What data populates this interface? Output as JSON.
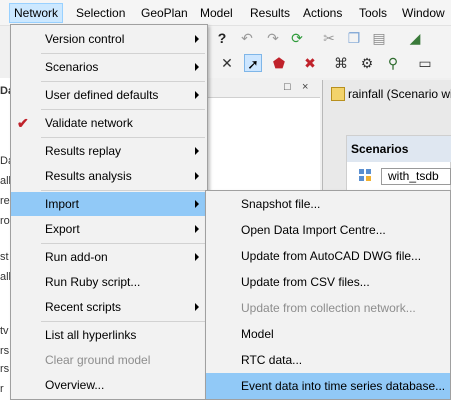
{
  "menubar": {
    "items": [
      "Network",
      "Selection",
      "GeoPlan",
      "Model",
      "Results",
      "Actions",
      "Tools",
      "Window"
    ]
  },
  "left_panel": {
    "title_fragment": "Da",
    "row_fragments": [
      "Da",
      "all",
      "re",
      "ro",
      "st",
      "all",
      "tv",
      "rs",
      "rs",
      "r"
    ]
  },
  "pane": {
    "buttons": [
      "□",
      "×"
    ]
  },
  "document": {
    "title": "rainfall (Scenario wi",
    "scenarios_header": "Scenarios",
    "scenario_value": "with_tsdb"
  },
  "network_menu": {
    "items": [
      {
        "label": "Version control",
        "submenu": true,
        "disabled": false
      },
      {
        "label": "Scenarios",
        "submenu": true,
        "disabled": false
      },
      {
        "label": "User defined defaults",
        "submenu": true,
        "disabled": false
      },
      {
        "label": "Validate network",
        "submenu": false,
        "disabled": false,
        "checked": true
      },
      {
        "label": "Results replay",
        "submenu": true,
        "disabled": false
      },
      {
        "label": "Results analysis",
        "submenu": true,
        "disabled": false
      },
      {
        "label": "Import",
        "submenu": true,
        "disabled": false,
        "highlighted": true
      },
      {
        "label": "Export",
        "submenu": true,
        "disabled": false
      },
      {
        "label": "Run add-on",
        "submenu": true,
        "disabled": false
      },
      {
        "label": "Run Ruby script...",
        "submenu": false,
        "disabled": false
      },
      {
        "label": "Recent scripts",
        "submenu": true,
        "disabled": false
      },
      {
        "label": "List all hyperlinks",
        "submenu": false,
        "disabled": false
      },
      {
        "label": "Clear ground model",
        "submenu": false,
        "disabled": true
      },
      {
        "label": "Overview...",
        "submenu": false,
        "disabled": false
      }
    ]
  },
  "import_submenu": {
    "items": [
      {
        "label": "Snapshot file...",
        "disabled": false
      },
      {
        "label": "Open Data Import Centre...",
        "disabled": false
      },
      {
        "label": "Update from AutoCAD DWG file...",
        "disabled": false
      },
      {
        "label": "Update from CSV files...",
        "disabled": false
      },
      {
        "label": "Update from collection network...",
        "disabled": true
      },
      {
        "label": "Model",
        "disabled": false
      },
      {
        "label": "RTC data...",
        "disabled": false
      },
      {
        "label": "Event data into time series database...",
        "disabled": false,
        "highlighted": true
      }
    ]
  },
  "colors": {
    "highlight": "#91c9f7",
    "menubar_active": "#cce8ff",
    "check": "#c0222b",
    "disabled_text": "#8d8d8d"
  }
}
